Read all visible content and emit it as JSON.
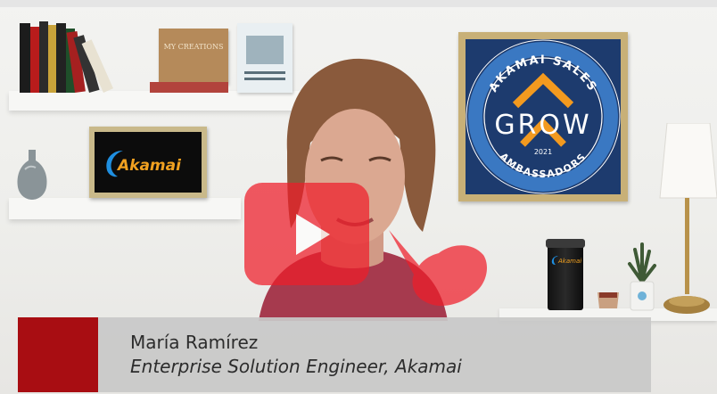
{
  "video": {
    "presenter_name": "María Ramírez",
    "presenter_title": "Enterprise Solution Engineer, Akamai",
    "play_icon": "play-icon"
  },
  "scene": {
    "akamai_logo_text": "Akamai",
    "grow_frame": {
      "top_text": "AKAMAI SALES",
      "main_text": "GROW",
      "year": "2021",
      "bottom_text": "AMBASSADORS"
    },
    "book_covers": [
      "MY CREATIONS"
    ],
    "tumbler_logo_text": "Akamai",
    "colors": {
      "caption_accent": "#a80d12",
      "play_button": "#ef1d2a",
      "grow_background": "#1d3b6e",
      "grow_orange": "#f39a1f"
    }
  }
}
